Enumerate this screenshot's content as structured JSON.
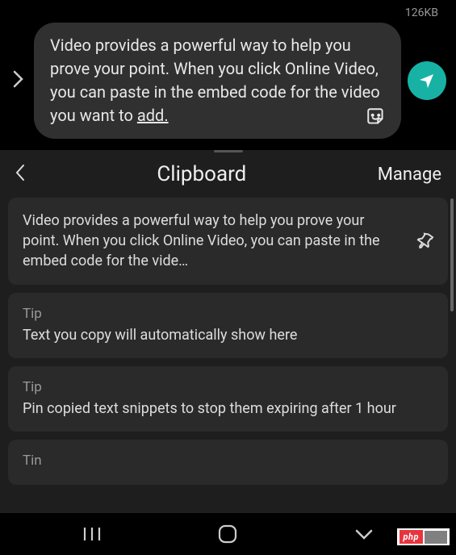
{
  "size_label": "126KB",
  "message": {
    "text": "Video provides a powerful way to help you prove your point. When you click Online Video, you can paste in the embed code for the video you want to ",
    "underlined_suffix": "add."
  },
  "clipboard": {
    "title": "Clipboard",
    "manage_label": "Manage",
    "items": [
      {
        "text": "Video provides a powerful way to help you prove your point. When you click Online Video, you can paste in the embed code for the vide…",
        "pinned": true
      },
      {
        "tip_label": "Tip",
        "text": "Text you copy will automatically show here"
      },
      {
        "tip_label": "Tip",
        "text": "Pin copied text snippets to stop them expiring after 1 hour"
      },
      {
        "tip_label": "Tin"
      }
    ]
  },
  "watermark": "php"
}
